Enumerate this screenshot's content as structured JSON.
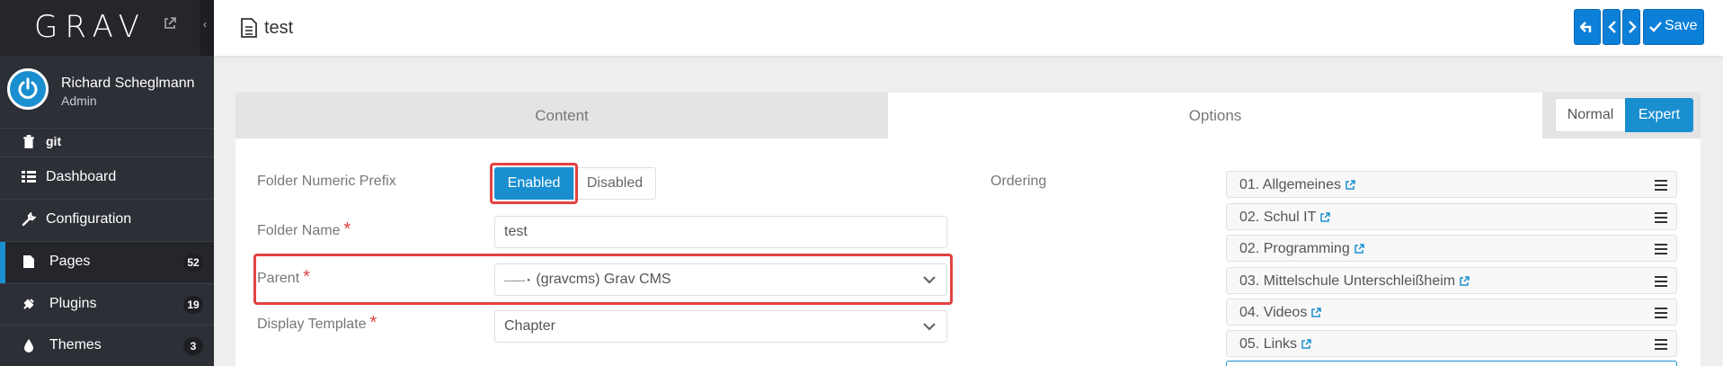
{
  "sidebar": {
    "logo": "GRAV",
    "collapse_glyph": "‹",
    "user": {
      "name": "Richard Scheglmann",
      "role": "Admin"
    },
    "items": [
      {
        "label": "git",
        "icon": "trash-icon",
        "count": ""
      },
      {
        "label": "Dashboard",
        "icon": "dashboard-grid-icon",
        "count": ""
      },
      {
        "label": "Configuration",
        "icon": "wrench-icon",
        "count": ""
      },
      {
        "label": "Pages",
        "icon": "file-icon",
        "count": "52",
        "active": true
      },
      {
        "label": "Plugins",
        "icon": "plug-icon",
        "count": "19"
      },
      {
        "label": "Themes",
        "icon": "tint-icon",
        "count": "3"
      }
    ]
  },
  "header": {
    "title": "test",
    "save_label": "Save"
  },
  "tabs": {
    "content": "Content",
    "options": "Options",
    "mode_normal": "Normal",
    "mode_expert": "Expert"
  },
  "form": {
    "folder_prefix_label": "Folder Numeric Prefix",
    "enabled": "Enabled",
    "disabled": "Disabled",
    "folder_name_label": "Folder Name",
    "folder_name_value": "test",
    "parent_label": "Parent",
    "parent_prefix": "—-—- ‣",
    "parent_value": "(gravcms) Grav CMS",
    "template_label": "Display Template",
    "template_value": "Chapter",
    "required_mark": "*",
    "ordering_label": "Ordering"
  },
  "ordering": [
    "01. Allgemeines",
    "02. Schul IT",
    "02. Programming",
    "03. Mittelschule Unterschleißheim",
    "04. Videos",
    "05. Links"
  ],
  "colors": {
    "accent": "#1a8fd0",
    "highlight": "#e34242",
    "sidebar": "#2d2f36"
  }
}
